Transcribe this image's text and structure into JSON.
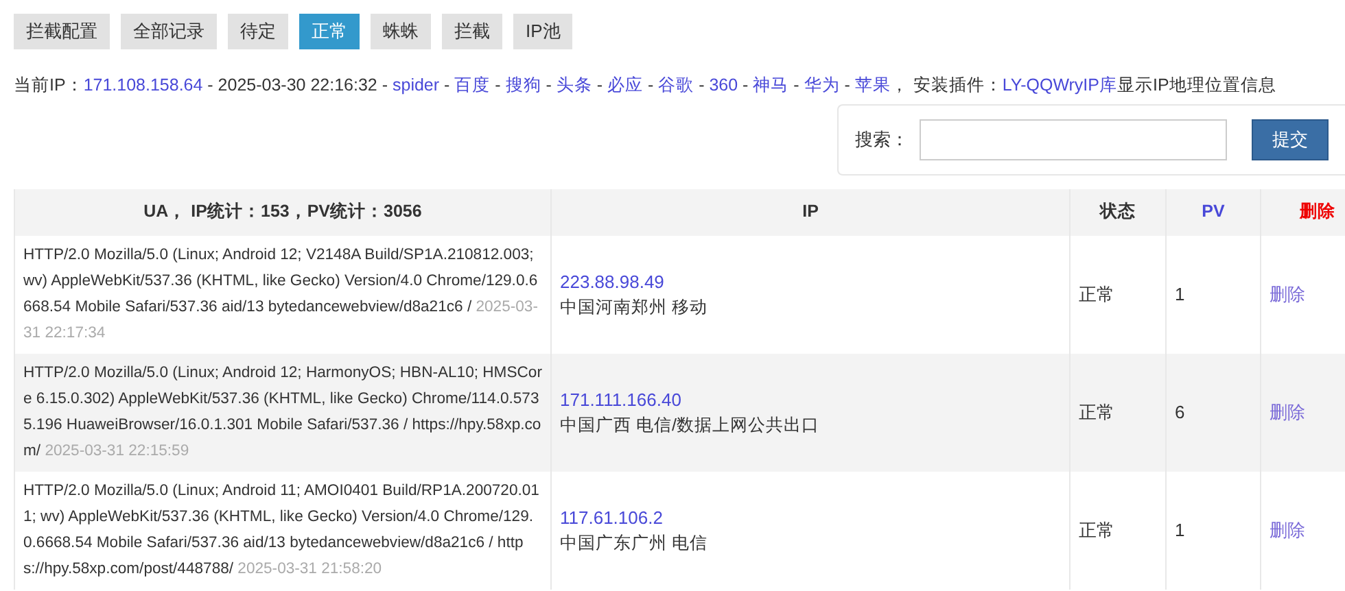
{
  "tabs": [
    {
      "label": "拦截配置",
      "selected": false
    },
    {
      "label": "全部记录",
      "selected": false
    },
    {
      "label": "待定",
      "selected": false
    },
    {
      "label": "正常",
      "selected": true
    },
    {
      "label": "蛛蛛",
      "selected": false
    },
    {
      "label": "拦截",
      "selected": false
    },
    {
      "label": "IP池",
      "selected": false
    }
  ],
  "info_line": [
    {
      "kind": "text",
      "text": "当前IP："
    },
    {
      "kind": "link",
      "text": "171.108.158.64"
    },
    {
      "kind": "text",
      "text": " - 2025-03-30 22:16:32 - "
    },
    {
      "kind": "link",
      "text": "spider"
    },
    {
      "kind": "text",
      "text": " - "
    },
    {
      "kind": "link",
      "text": "百度"
    },
    {
      "kind": "text",
      "text": " - "
    },
    {
      "kind": "link",
      "text": "搜狗"
    },
    {
      "kind": "text",
      "text": " - "
    },
    {
      "kind": "link",
      "text": "头条"
    },
    {
      "kind": "text",
      "text": " - "
    },
    {
      "kind": "link",
      "text": "必应"
    },
    {
      "kind": "text",
      "text": " - "
    },
    {
      "kind": "link",
      "text": "谷歌"
    },
    {
      "kind": "text",
      "text": " - "
    },
    {
      "kind": "link",
      "text": "360"
    },
    {
      "kind": "text",
      "text": " - "
    },
    {
      "kind": "link",
      "text": "神马"
    },
    {
      "kind": "text",
      "text": " - "
    },
    {
      "kind": "link",
      "text": "华为"
    },
    {
      "kind": "text",
      "text": " - "
    },
    {
      "kind": "link",
      "text": "苹果"
    },
    {
      "kind": "text",
      "text": "， 安装插件："
    },
    {
      "kind": "link",
      "text": "LY-QQWryIP库"
    },
    {
      "kind": "text",
      "text": "显示IP地理位置信息"
    }
  ],
  "search": {
    "label": "搜索：",
    "button": "提交"
  },
  "table": {
    "columns": [
      "UA， IP统计：153，PV统计：3056",
      "IP",
      "状态",
      "PV",
      "删除"
    ],
    "rows": [
      {
        "ua": "HTTP/2.0 Mozilla/5.0 (Linux; Android 12; V2148A Build/SP1A.210812.003; wv) AppleWebKit/537.36 (KHTML, like Gecko) Version/4.0 Chrome/129.0.6668.54 Mobile Safari/537.36 aid/13 bytedancewebview/d8a21c6 / ",
        "time": "2025-03-31 22:17:34",
        "ip": "223.88.98.49",
        "location": "中国河南郑州 移动",
        "status": "正常",
        "pv": "1",
        "action": "删除"
      },
      {
        "ua": "HTTP/2.0 Mozilla/5.0 (Linux; Android 12; HarmonyOS; HBN-AL10; HMSCore 6.15.0.302) AppleWebKit/537.36 (KHTML, like Gecko) Chrome/114.0.5735.196 HuaweiBrowser/16.0.1.301 Mobile Safari/537.36 / https://hpy.58xp.com/ ",
        "time": "2025-03-31 22:15:59",
        "ip": "171.111.166.40",
        "location": "中国广西 电信/数据上网公共出口",
        "status": "正常",
        "pv": "6",
        "action": "删除"
      },
      {
        "ua": "HTTP/2.0 Mozilla/5.0 (Linux; Android 11; AMOI0401 Build/RP1A.200720.011; wv) AppleWebKit/537.36 (KHTML, like Gecko) Version/4.0 Chrome/129.0.6668.54 Mobile Safari/537.36 aid/13 bytedancewebview/d8a21c6 / https://hpy.58xp.com/post/448788/ ",
        "time": "2025-03-31 21:58:20",
        "ip": "117.61.106.2",
        "location": "中国广东广州 电信",
        "status": "正常",
        "pv": "1",
        "action": "删除"
      }
    ]
  }
}
